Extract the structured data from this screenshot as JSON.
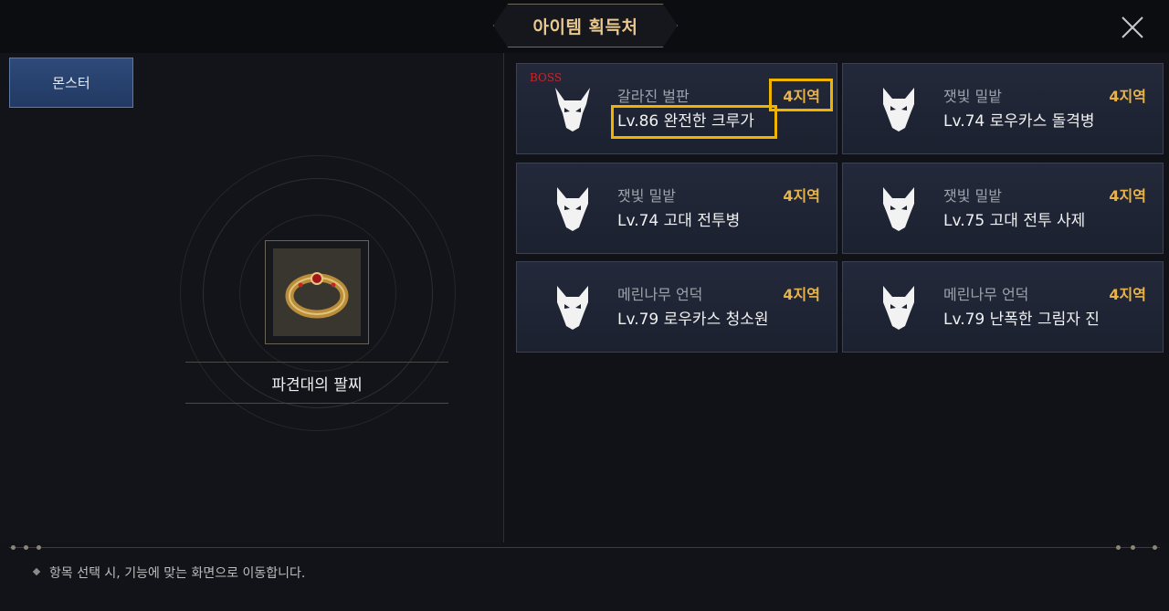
{
  "header": {
    "title": "아이템 획득처"
  },
  "tabs": [
    {
      "label": "몬스터"
    }
  ],
  "item": {
    "name": "파견대의 팔찌"
  },
  "sources": [
    {
      "boss_tag": "BOSS",
      "region": "갈라진 벌판",
      "zone": "4지역",
      "mob": "Lv.86 완전한 크루가"
    },
    {
      "boss_tag": "",
      "region": "잿빛 밀밭",
      "zone": "4지역",
      "mob": "Lv.74 로우카스 돌격병"
    },
    {
      "boss_tag": "",
      "region": "잿빛 밀밭",
      "zone": "4지역",
      "mob": "Lv.74 고대 전투병"
    },
    {
      "boss_tag": "",
      "region": "잿빛 밀밭",
      "zone": "4지역",
      "mob": "Lv.75 고대 전투 사제"
    },
    {
      "boss_tag": "",
      "region": "메린나무 언덕",
      "zone": "4지역",
      "mob": "Lv.79 로우카스 청소원"
    },
    {
      "boss_tag": "",
      "region": "메린나무 언덕",
      "zone": "4지역",
      "mob": "Lv.79 난폭한 그림자 진"
    }
  ],
  "footer": {
    "hint": "항목 선택 시, 기능에 맞는 화면으로 이동합니다."
  },
  "colors": {
    "zone": "#e8b449",
    "highlight": "#f0b400",
    "tab": "#2e4a7a",
    "boss": "#c8262a"
  }
}
